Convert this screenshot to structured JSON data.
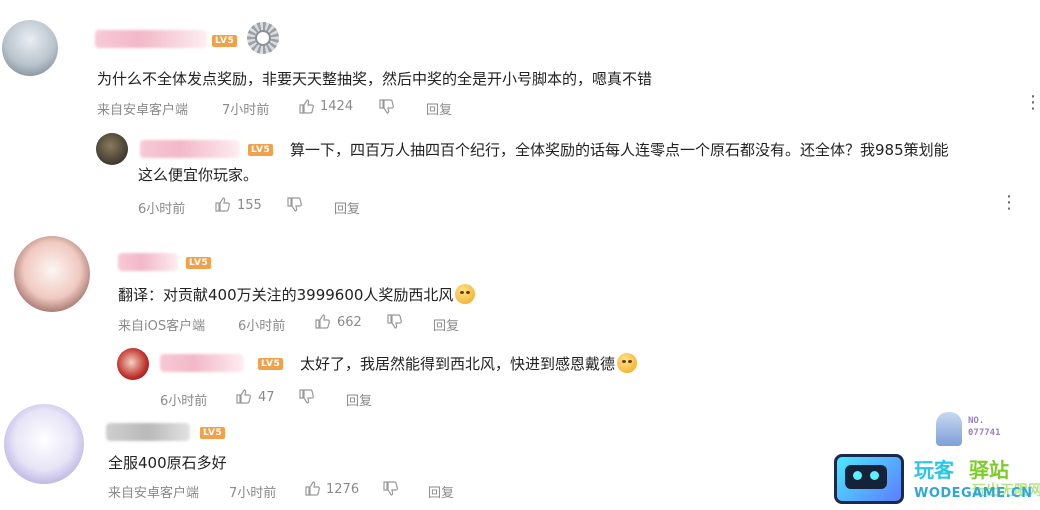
{
  "comments": [
    {
      "level": "LV5",
      "text": "为什么不全体发点奖励，非要天天整抽奖，然后中奖的全是开小号脚本的，嗯真不错",
      "source": "来自安卓客户端",
      "time": "7小时前",
      "likes": "1424",
      "reply_label": "回复"
    },
    {
      "level": "LV5",
      "text_line1": "算一下，四百万人抽四百个纪行，全体奖励的话每人连零点一个原石都没有。还全体？我985策划能",
      "text_line2": "这么便宜你玩家。",
      "time": "6小时前",
      "likes": "155",
      "reply_label": "回复"
    },
    {
      "level": "LV5",
      "text": "翻译：对贡献400万关注的3999600人奖励西北风",
      "source": "来自iOS客户端",
      "time": "6小时前",
      "likes": "662",
      "reply_label": "回复"
    },
    {
      "level": "LV5",
      "text": "太好了，我居然能得到西北风，快进到感恩戴德",
      "time": "6小时前",
      "likes": "47",
      "reply_label": "回复"
    },
    {
      "level": "LV5",
      "text": "全服400原石多好",
      "source": "来自安卓客户端",
      "time": "7小时前",
      "likes": "1276",
      "reply_label": "回复"
    }
  ],
  "badge": {
    "text_line1": "NO.",
    "text_line2": "077741"
  },
  "watermark": {
    "title_left": "玩客",
    "title_right": "驿站",
    "sub_cn": "玩出无限网",
    "domain": "WODEGAME.CN"
  },
  "colors": {
    "level_badge": "#f0a14a",
    "meta_text": "#8a8a8a",
    "watermark_cyan": "#29c7e6",
    "watermark_green": "#7ccc2a"
  }
}
